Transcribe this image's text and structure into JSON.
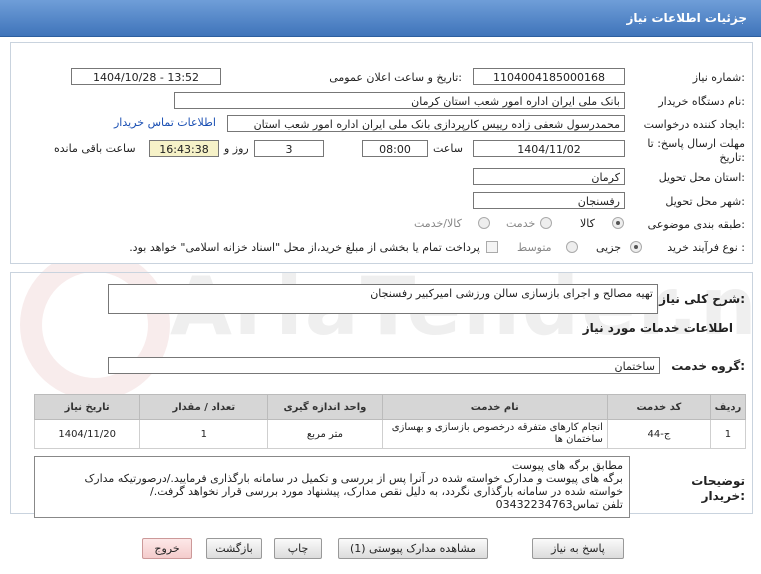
{
  "header": {
    "title": "جزئیات اطلاعات نیاز"
  },
  "form": {
    "need_number_label": "شماره نیاز:",
    "need_number": "1104004185000168",
    "announce_label": "تاریخ و ساعت اعلان عمومی:",
    "announce_value": "1404/10/28 - 13:52",
    "buyer_org_label": "نام دستگاه خریدار:",
    "buyer_org": "بانک ملی ایران اداره امور شعب استان کرمان",
    "creator_label": "ایجاد کننده درخواست:",
    "creator": "محمدرسول شعفی زاده رییس کارپردازی بانک ملی ایران اداره امور شعب استان",
    "contact_link": "اطلاعات تماس خریدار",
    "deadline_label_1": "مهلت ارسال پاسخ: تا",
    "deadline_label_2": "تاریخ:",
    "deadline_date": "1404/11/02",
    "time_label": "ساعت",
    "deadline_time": "08:00",
    "days_value": "3",
    "days_label": "روز و",
    "remaining_time": "16:43:38",
    "remaining_label": "ساعت باقی مانده",
    "province_label": "استان محل تحویل:",
    "province": "کرمان",
    "city_label": "شهر محل تحویل:",
    "city": "رفسنجان",
    "category_label": "طبقه بندی موضوعی:",
    "category_options": [
      "کالا",
      "خدمت",
      "کالا/خدمت"
    ],
    "category_selected": "کالا",
    "process_label": "نوع فرآیند خرید :",
    "process_options": [
      "جزیی",
      "متوسط"
    ],
    "process_selected": "جزیی",
    "payment_note": "پرداخت تمام یا بخشی از مبلغ خرید،از محل \"اسناد خزانه اسلامی\" خواهد بود."
  },
  "details": {
    "need_desc_label": "شرح کلی نیاز:",
    "need_desc": "تهیه مصالح و اجرای بازسازی سالن ورزشی امیرکبیر رفسنجان",
    "services_heading": "اطلاعات خدمات مورد نیاز",
    "service_group_label": "گروه خدمت:",
    "service_group": "ساختمان",
    "table_headers": [
      "ردیف",
      "کد خدمت",
      "نام خدمت",
      "واحد اندازه گیری",
      "تعداد / مقدار",
      "تاریخ نیاز"
    ],
    "rows": [
      {
        "row": "1",
        "code": "ج-44",
        "name": "انجام کارهای متفرقه درخصوص بازسازی و بهسازی ساختمان ها",
        "unit": "متر مربع",
        "qty": "1",
        "date": "1404/11/20"
      }
    ],
    "buyer_notes_label_1": "توضیحات",
    "buyer_notes_label_2": "خریدار:",
    "buyer_notes": [
      "مطابق برگه های پیوست",
      "برگه های پیوست و مدارک خواسته شده در آنرا پس از بررسی و تکمیل در سامانه بارگذاری فرمایید./درصورتیکه مدارک",
      "خواسته شده در سامانه بارگذاری نگردد، به دلیل نقص مدارک، پیشنهاد مورد بررسی قرار نخواهد گرفت./",
      "تلفن تماس03432234763"
    ]
  },
  "buttons": {
    "reply": "پاسخ به نیاز",
    "attachments": "مشاهده مدارک پیوستی (1)",
    "print": "چاپ",
    "back": "بازگشت",
    "exit": "خروج"
  },
  "watermark": "AriaTender.net"
}
